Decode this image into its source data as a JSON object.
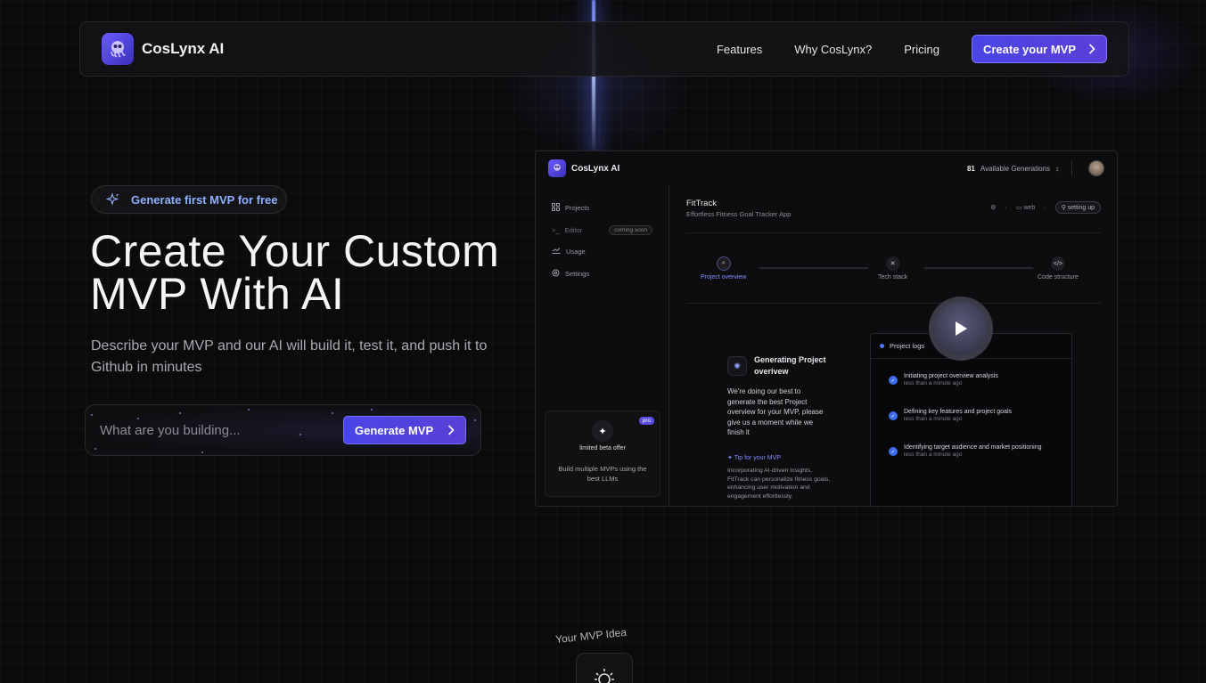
{
  "nav": {
    "brand": "CosLynx AI",
    "links": [
      "Features",
      "Why CosLynx?",
      "Pricing"
    ],
    "cta": "Create your MVP"
  },
  "hero": {
    "pill": "Generate first MVP for free",
    "title": "Create Your Custom MVP With AI",
    "subtitle": "Describe your MVP and our AI will build it, test it, and push it to Github in minutes",
    "input_placeholder": "What are you building...",
    "button": "Generate MVP"
  },
  "preview": {
    "brand": "CosLynx AI",
    "generations_count": "81",
    "generations_label": "Available Generations",
    "sidebar": [
      {
        "label": "Projects",
        "icon": "grid-icon"
      },
      {
        "label": "Editor",
        "icon": "terminal-icon",
        "badge": "coming soon"
      },
      {
        "label": "Usage",
        "icon": "chart-icon"
      },
      {
        "label": "Settings",
        "icon": "gear-icon"
      }
    ],
    "beta": {
      "badge": "pro",
      "title": "limited beta offer",
      "text": "Build multiple MVPs using the best LLMs"
    },
    "project": {
      "title": "FitTrack",
      "subtitle": "Effortless Fitness Goal Tracker App",
      "platform": "web",
      "status": "setting up"
    },
    "steps": [
      "Project overview",
      "Tech stack",
      "Code structure"
    ],
    "generating": {
      "title": "Generating Project overivew",
      "body": "We're doing our best to generate the best Project overview for your MVP, please give us a moment while we finish it",
      "tip_label": "Tip for your MVP",
      "tip_body": "Incorporating AI-driven insights, FitTrack can personalize fitness goals, enhancing user motivation and engagement effortlessly."
    },
    "logs": {
      "title": "Project logs",
      "items": [
        {
          "text": "Initiating project overview analysis",
          "time": "less than a minute ago"
        },
        {
          "text": "Defining key features and project goals",
          "time": "less than a minute ago"
        },
        {
          "text": "Identifying target audience and market positioning",
          "time": "less than a minute ago"
        }
      ]
    }
  },
  "bottom": {
    "idea_label": "Your MVP Idea"
  },
  "colors": {
    "accent": "#4a45e6",
    "accent_text": "#8fb0ff",
    "background": "#0b0b0c"
  }
}
